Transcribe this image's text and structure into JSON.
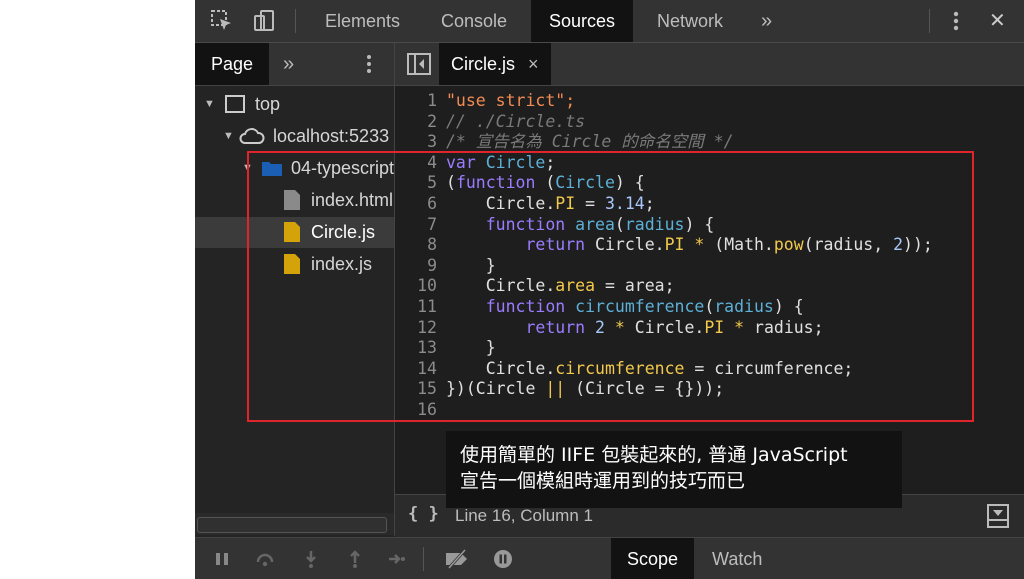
{
  "toolbar": {
    "tabs": [
      {
        "label": "Elements"
      },
      {
        "label": "Console"
      },
      {
        "label": "Sources"
      },
      {
        "label": "Network"
      }
    ],
    "more": "»",
    "close": "✕"
  },
  "navigator": {
    "tab": "Page",
    "more": "»",
    "tree": [
      {
        "label": "top"
      },
      {
        "label": "localhost:5233"
      },
      {
        "label": "04-typescript"
      },
      {
        "label": "index.html"
      },
      {
        "label": "Circle.js"
      },
      {
        "label": "index.js"
      }
    ]
  },
  "editor": {
    "file_tab": "Circle.js",
    "file_tab_close": "×",
    "line_numbers": [
      "1",
      "2",
      "3",
      "4",
      "5",
      "6",
      "7",
      "8",
      "9",
      "10",
      "11",
      "12",
      "13",
      "14",
      "15",
      "16"
    ],
    "code": {
      "l1": "\"use strict\";",
      "l2": "// ./Circle.ts",
      "l3": "/* 宣告名為 Circle 的命名空間 */",
      "var": "var",
      "circle": "Circle",
      "semi": ";",
      "open_paren": "(",
      "function": "function",
      "space": " ",
      "open_brace": ") {",
      "dot": ".",
      "PI": "PI",
      "eq": " = ",
      "pi_val": "3.14",
      "area": "area",
      "radius": "radius",
      "return": "return",
      "math_pre": " (Math.",
      "pow": "pow",
      "two": "2",
      "close_pow": "));",
      "close_brace": "}",
      "assign_area": "area;",
      "circumference": "circumference",
      "assign_circ": "circumference;",
      "l15_a": "})(Circle ",
      "or": "||",
      "l15_b": " (Circle = {}));",
      "star": "*",
      "pi_semi": "PI",
      "radius_semi": "radius;"
    },
    "status": "Line 16, Column 1",
    "format_icon": "{ }"
  },
  "caption": {
    "line1": "使用簡單的 IIFE 包裝起來的, 普通 JavaScript",
    "line2": "宣告一個模組時運用到的技巧而已"
  },
  "debugger": {
    "tabs": [
      {
        "label": "Scope"
      },
      {
        "label": "Watch"
      }
    ]
  }
}
